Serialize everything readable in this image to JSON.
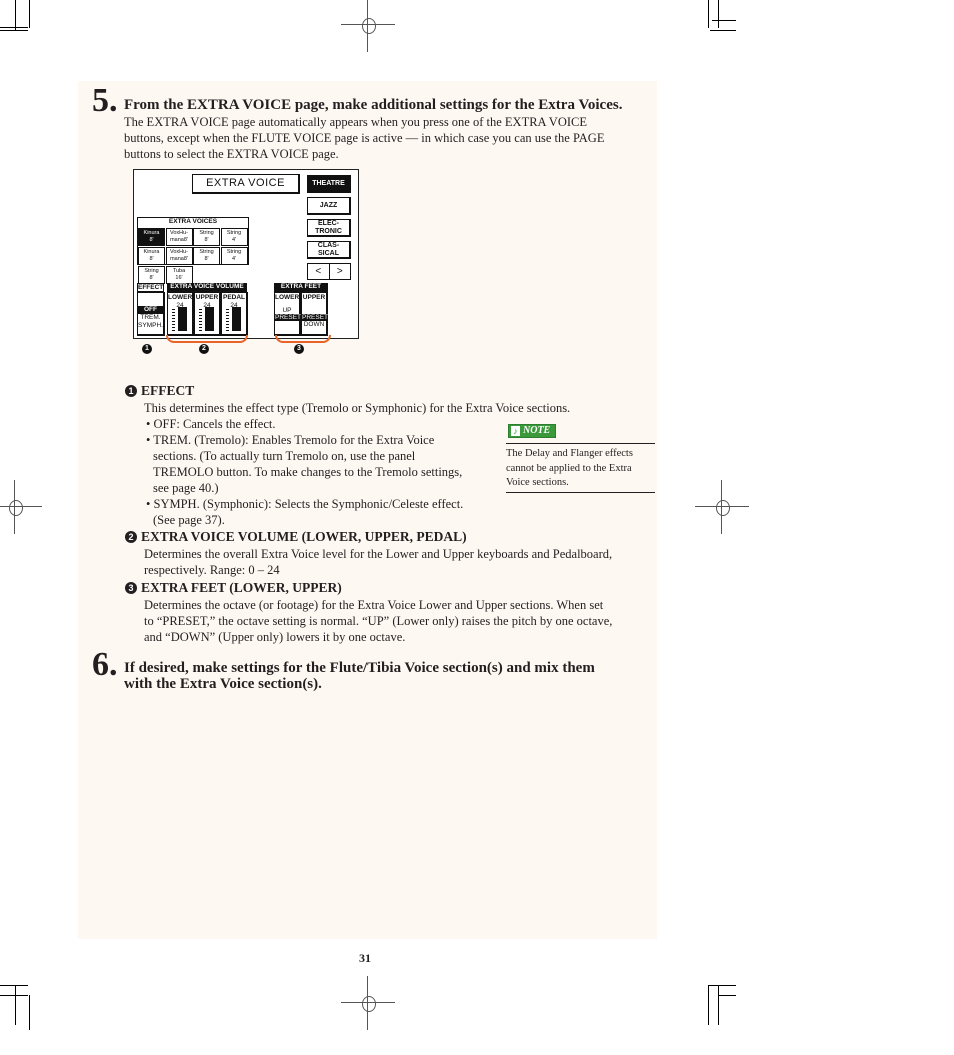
{
  "step5": {
    "number": "5.",
    "title": "From the EXTRA VOICE page, make additional settings for the Extra Voices.",
    "body_lines": [
      "The EXTRA VOICE page automatically appears when you press one of the EXTRA VOICE",
      "buttons, except when the FLUTE VOICE page is active — in which case you can use the PAGE",
      "buttons to select the EXTRA VOICE page."
    ]
  },
  "screen": {
    "title": "EXTRA VOICE",
    "side_buttons": [
      {
        "label": "THEATRE",
        "selected": true
      },
      {
        "label": "JAZZ",
        "selected": false
      },
      {
        "label": "ELEC-\nTRONIC",
        "selected": false
      },
      {
        "label": "CLAS-\nSICAL",
        "selected": false
      }
    ],
    "page_prev": "<",
    "page_next": ">",
    "extra_voices_label": "EXTRA VOICES",
    "voices": [
      {
        "name": "Kinura",
        "feet": "8'",
        "selected": true
      },
      {
        "name": "VoxHu-",
        "feet": "mana8'",
        "selected": false
      },
      {
        "name": "String",
        "feet": "8'",
        "selected": false
      },
      {
        "name": "String",
        "feet": "4'",
        "selected": false
      },
      {
        "name": "Kinura",
        "feet": "8'",
        "selected": false
      },
      {
        "name": "VoxHu-",
        "feet": "mana8'",
        "selected": false
      },
      {
        "name": "String",
        "feet": "8'",
        "selected": false
      },
      {
        "name": "String",
        "feet": "4'",
        "selected": false
      },
      {
        "name": "String",
        "feet": "8'",
        "selected": false
      },
      {
        "name": "Tuba",
        "feet": "16'",
        "selected": false
      }
    ],
    "effect_label": "EFFECT",
    "effect_options": [
      "OFF",
      "TREM.",
      "SYMPH."
    ],
    "effect_selected": "OFF",
    "volume_label": "EXTRA VOICE VOLUME",
    "volumes": [
      {
        "label": "LOWER",
        "value": "24",
        "level": 24,
        "max": 24
      },
      {
        "label": "UPPER",
        "value": "24",
        "level": 24,
        "max": 24
      },
      {
        "label": "PEDAL",
        "value": "24",
        "level": 24,
        "max": 24
      }
    ],
    "feet_label": "EXTRA FEET",
    "feet": [
      {
        "label": "LOWER",
        "options": [
          "UP",
          "PRESET"
        ],
        "selected": "PRESET"
      },
      {
        "label": "UPPER",
        "options": [
          "PRESET",
          "DOWN"
        ],
        "selected": "PRESET"
      }
    ],
    "markers": [
      "1",
      "2",
      "3"
    ],
    "accent_color": "#e8652a"
  },
  "items": {
    "effect": {
      "marker": "1",
      "heading": "EFFECT",
      "intro": "This determines the effect type (Tremolo or Symphonic) for the Extra Voice sections.",
      "bullets": [
        [
          "• OFF: Cancels the effect."
        ],
        [
          "• TREM. (Tremolo): Enables Tremolo for the Extra Voice",
          "sections.  (To actually turn Tremolo on, use the panel",
          "TREMOLO button.  To make changes to the Tremolo settings,",
          "see page 40.)"
        ],
        [
          "• SYMPH. (Symphonic): Selects the Symphonic/Celeste effect.",
          "(See page 37)."
        ]
      ]
    },
    "volume": {
      "marker": "2",
      "heading": "EXTRA VOICE VOLUME (LOWER, UPPER, PEDAL)",
      "body_lines": [
        "Determines the overall Extra Voice level for the Lower and Upper keyboards and Pedalboard,",
        "respectively.  Range: 0 – 24"
      ]
    },
    "feet": {
      "marker": "3",
      "heading": "EXTRA FEET (LOWER, UPPER)",
      "body_lines": [
        "Determines the octave (or footage) for the Extra Voice Lower and Upper sections.  When set",
        "to “PRESET,” the octave setting is normal.  “UP” (Lower only) raises the pitch by one octave,",
        "and “DOWN” (Upper only) lowers it by one octave."
      ]
    }
  },
  "note": {
    "icon": "music-note-icon",
    "label": "NOTE",
    "lines": [
      "The Delay and Flanger effects",
      "cannot be applied to the Extra",
      "Voice sections."
    ],
    "color": "#3a9a3a"
  },
  "step6": {
    "number": "6.",
    "title_lines": [
      "If desired, make settings for the Flute/Tibia Voice section(s) and mix them",
      "with the Extra Voice section(s)."
    ]
  },
  "page_number": "31"
}
